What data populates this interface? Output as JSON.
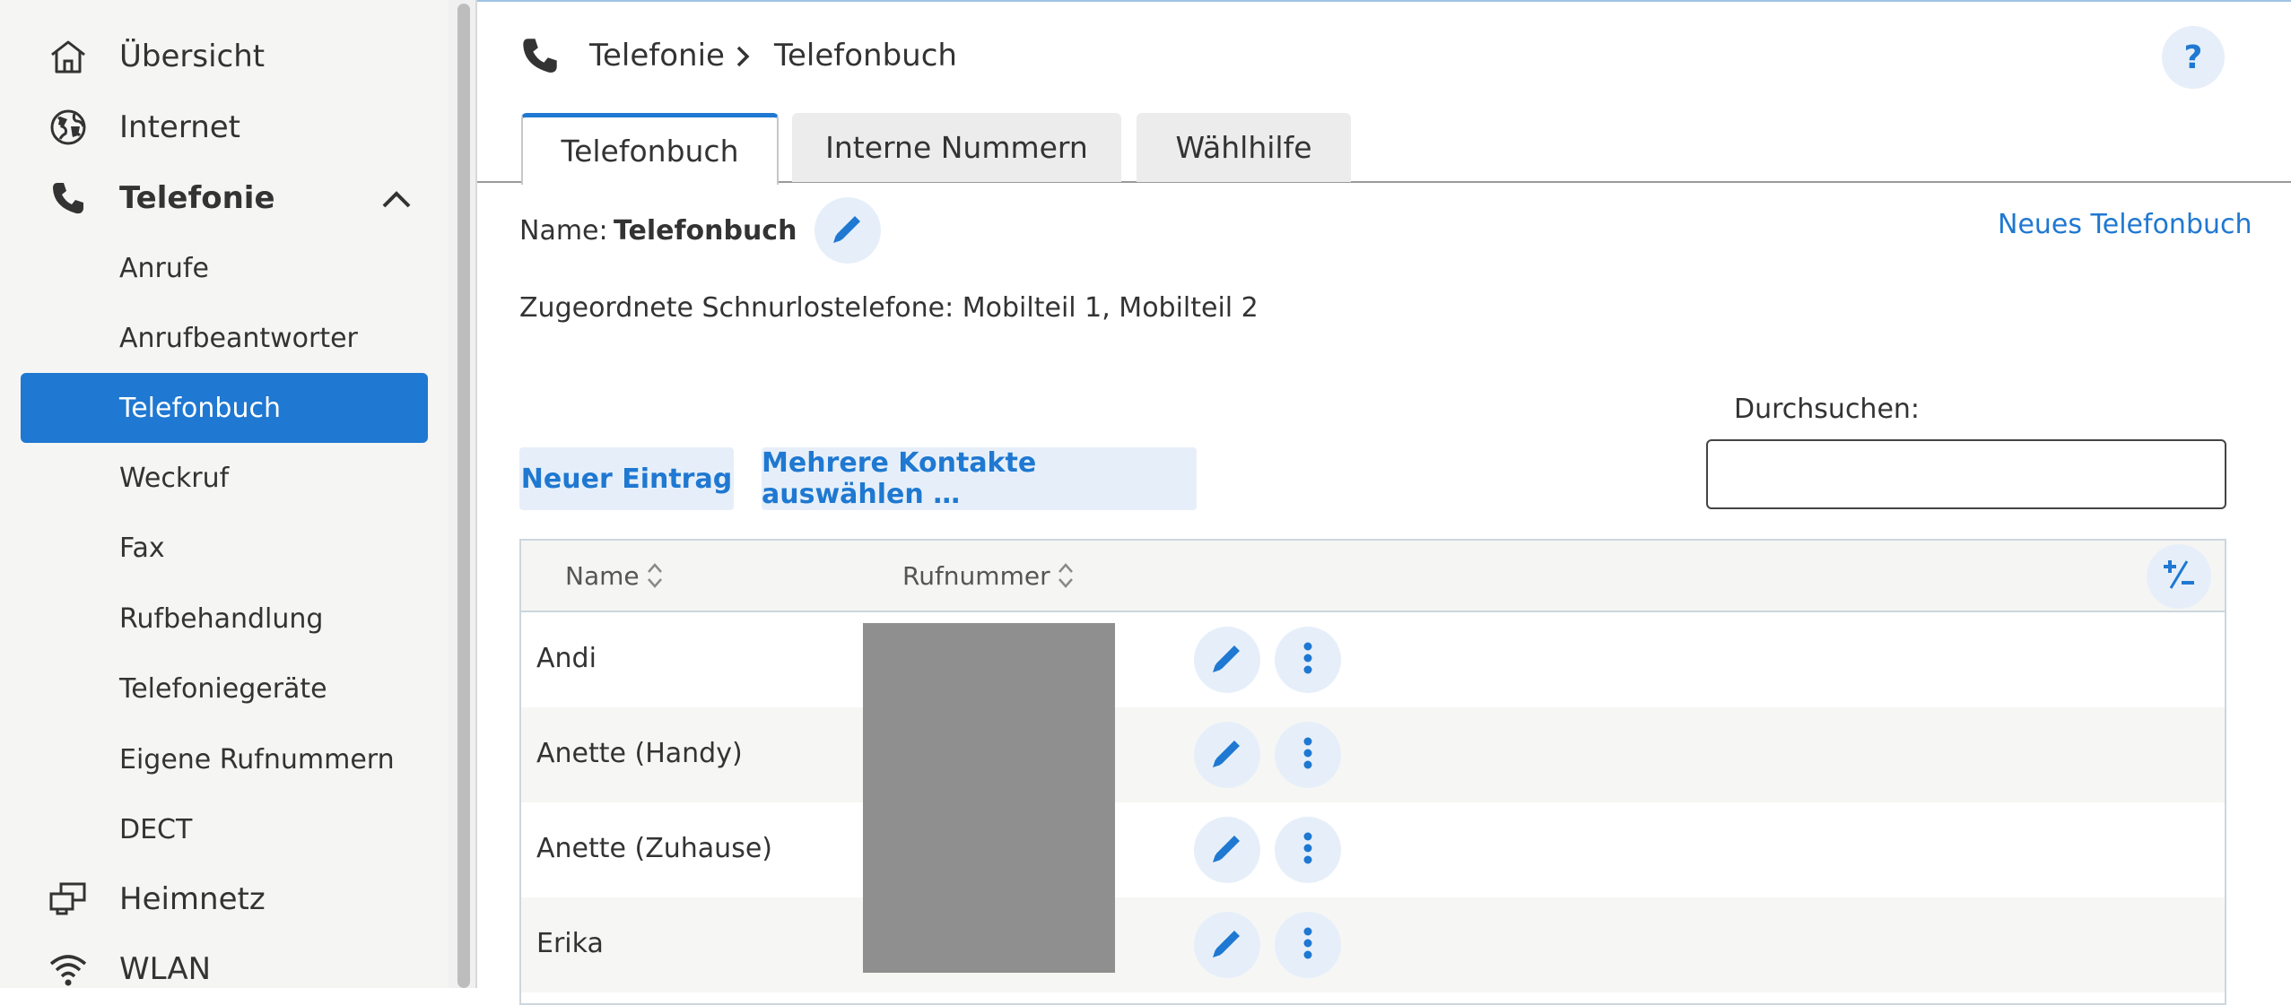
{
  "sidebar": {
    "items": [
      {
        "label": "Übersicht",
        "icon": "home-icon"
      },
      {
        "label": "Internet",
        "icon": "globe-icon"
      },
      {
        "label": "Telefonie",
        "icon": "phone-icon"
      },
      {
        "label": "Heimnetz",
        "icon": "network-icon"
      },
      {
        "label": "WLAN",
        "icon": "wifi-icon"
      }
    ],
    "subitems": [
      {
        "label": "Anrufe"
      },
      {
        "label": "Anrufbeantworter"
      },
      {
        "label": "Telefonbuch"
      },
      {
        "label": "Weckruf"
      },
      {
        "label": "Fax"
      },
      {
        "label": "Rufbehandlung"
      },
      {
        "label": "Telefoniegeräte"
      },
      {
        "label": "Eigene Rufnummern"
      },
      {
        "label": "DECT"
      }
    ]
  },
  "header": {
    "breadcrumb": [
      "Telefonie",
      "Telefonbuch"
    ],
    "help_label": "?"
  },
  "tabs": [
    {
      "label": "Telefonbuch",
      "active": true
    },
    {
      "label": "Interne Nummern",
      "active": false
    },
    {
      "label": "Wählhilfe",
      "active": false
    }
  ],
  "phonebook": {
    "name_label": "Name:",
    "name_value": "Telefonbuch",
    "new_phonebook_link": "Neues Telefonbuch",
    "assigned_text": "Zugeordnete Schnurlostelefone: Mobilteil 1, Mobilteil 2"
  },
  "toolbar": {
    "new_entry": "Neuer Eintrag",
    "select_multiple": "Mehrere Kontakte auswählen …",
    "search_label": "Durchsuchen:",
    "search_value": ""
  },
  "table": {
    "columns": [
      "Name",
      "Rufnummer"
    ],
    "rows": [
      {
        "name": "Andi"
      },
      {
        "name": "Anette (Handy)"
      },
      {
        "name": "Anette (Zuhause)"
      },
      {
        "name": "Erika"
      }
    ]
  },
  "colors": {
    "accent": "#1f78d1",
    "accent_light": "#e6eff9",
    "sidebar_bg": "#f5f5f4",
    "redaction": "#8f8f8f"
  }
}
